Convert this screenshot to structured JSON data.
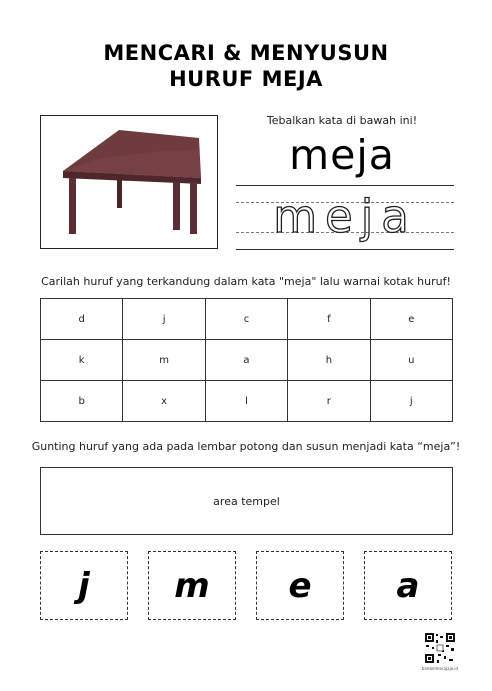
{
  "title": {
    "line1": "MENCARI & MENYUSUN",
    "line2": "HURUF MEJA"
  },
  "picture": {
    "subject": "table-illustration",
    "colors": {
      "top": "#6e3b3f",
      "legs": "#5a2e32"
    }
  },
  "trace": {
    "instruction": "Tebalkan kata di bawah ini!",
    "word": "meja",
    "traced_word": "meja"
  },
  "find": {
    "instruction": "Carilah huruf yang terkandung dalam kata \"meja\" lalu warnai kotak huruf!",
    "grid": [
      [
        "d",
        "j",
        "c",
        "f",
        "e"
      ],
      [
        "k",
        "m",
        "a",
        "h",
        "u"
      ],
      [
        "b",
        "x",
        "l",
        "r",
        "j"
      ]
    ]
  },
  "arrange": {
    "instruction": "Gunting huruf yang ada pada lembar potong dan susun menjadi kata “meja”!",
    "paste_area": "area tempel",
    "cards": [
      "j",
      "m",
      "e",
      "a"
    ]
  },
  "footer": {
    "url": "bimbelmerajaja.id"
  }
}
